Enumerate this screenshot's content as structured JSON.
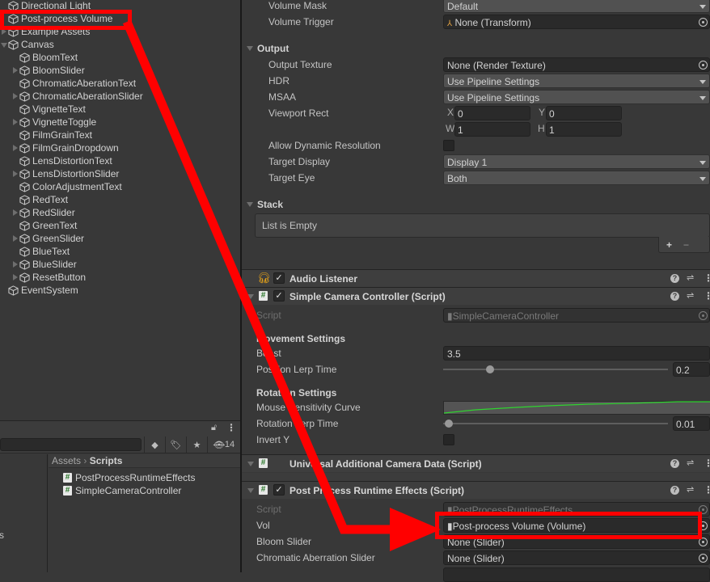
{
  "hierarchy": {
    "items": [
      {
        "label": "Directional Light",
        "indent": 0,
        "expandable": false
      },
      {
        "label": "Post-process Volume",
        "indent": 0,
        "expandable": false,
        "highlighted": true
      },
      {
        "label": "Example Assets",
        "indent": 0,
        "expandable": true
      },
      {
        "label": "Canvas",
        "indent": 0,
        "expandable": true,
        "expanded": true
      },
      {
        "label": "BloomText",
        "indent": 1,
        "expandable": false
      },
      {
        "label": "BloomSlider",
        "indent": 1,
        "expandable": true
      },
      {
        "label": "ChromaticAberationText",
        "indent": 1,
        "expandable": false
      },
      {
        "label": "ChromaticAberationSlider",
        "indent": 1,
        "expandable": true
      },
      {
        "label": "VignetteText",
        "indent": 1,
        "expandable": false
      },
      {
        "label": "VignetteToggle",
        "indent": 1,
        "expandable": true
      },
      {
        "label": "FilmGrainText",
        "indent": 1,
        "expandable": false
      },
      {
        "label": "FilmGrainDropdown",
        "indent": 1,
        "expandable": true
      },
      {
        "label": "LensDistortionText",
        "indent": 1,
        "expandable": false
      },
      {
        "label": "LensDistortionSlider",
        "indent": 1,
        "expandable": true
      },
      {
        "label": "ColorAdjustmentText",
        "indent": 1,
        "expandable": false
      },
      {
        "label": "RedText",
        "indent": 1,
        "expandable": false
      },
      {
        "label": "RedSlider",
        "indent": 1,
        "expandable": true
      },
      {
        "label": "GreenText",
        "indent": 1,
        "expandable": false
      },
      {
        "label": "GreenSlider",
        "indent": 1,
        "expandable": true
      },
      {
        "label": "BlueText",
        "indent": 1,
        "expandable": false
      },
      {
        "label": "BlueSlider",
        "indent": 1,
        "expandable": true
      },
      {
        "label": "ResetButton",
        "indent": 1,
        "expandable": true
      },
      {
        "label": "EventSystem",
        "indent": 0,
        "expandable": false
      }
    ]
  },
  "project": {
    "hidden_count": "14",
    "left_partial_text": "s",
    "breadcrumb": {
      "root": "Assets",
      "current": "Scripts"
    },
    "assets": [
      "PostProcessRuntimeEffects",
      "SimpleCameraController"
    ]
  },
  "inspector": {
    "camera": {
      "volume_mask_label": "Volume Mask",
      "volume_mask_value": "Default",
      "volume_trigger_label": "Volume Trigger",
      "volume_trigger_value": "None (Transform)",
      "output_section": "Output",
      "output_texture_label": "Output Texture",
      "output_texture_value": "None (Render Texture)",
      "hdr_label": "HDR",
      "hdr_value": "Use Pipeline Settings",
      "msaa_label": "MSAA",
      "msaa_value": "Use Pipeline Settings",
      "viewport_label": "Viewport Rect",
      "viewport": {
        "x_label": "X",
        "x": "0",
        "y_label": "Y",
        "y": "0",
        "w_label": "W",
        "w": "1",
        "h_label": "H",
        "h": "1"
      },
      "dynres_label": "Allow Dynamic Resolution",
      "dynres_checked": false,
      "target_display_label": "Target Display",
      "target_display_value": "Display 1",
      "target_eye_label": "Target Eye",
      "target_eye_value": "Both",
      "stack_section": "Stack",
      "stack_empty": "List is Empty",
      "add_label": "+",
      "remove_label": "−"
    },
    "audio_listener": {
      "title": "Audio Listener",
      "enabled": true
    },
    "simple_camera": {
      "title": "Simple Camera Controller (Script)",
      "enabled": true,
      "script_label": "Script",
      "script_value": "SimpleCameraController",
      "movement_section": "Movement Settings",
      "boost_label": "Boost",
      "boost_value": "3.5",
      "pos_lerp_label": "Position Lerp Time",
      "pos_lerp_value": "0.2",
      "rotation_section": "Rotation Settings",
      "mouse_curve_label": "Mouse Sensitivity Curve",
      "rot_lerp_label": "Rotation Lerp Time",
      "rot_lerp_value": "0.01",
      "invert_y_label": "Invert Y",
      "invert_y_checked": false
    },
    "urp_camera": {
      "title": "Universal Additional Camera Data (Script)"
    },
    "post_process": {
      "title": "Post Process Runtime Effects (Script)",
      "enabled": true,
      "script_label": "Script",
      "script_value": "PostProcessRuntimeEffects",
      "vol_label": "Vol",
      "vol_value": "Post-process Volume (Volume)",
      "bloom_label": "Bloom Slider",
      "bloom_value": "None (Slider)",
      "chroma_label": "Chromatic Aberration Slider",
      "chroma_value": "None (Slider)"
    }
  },
  "annotation": {
    "color": "#ff0000"
  }
}
